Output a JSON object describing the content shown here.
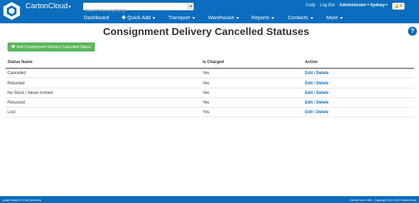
{
  "header": {
    "brand": "CartonCloud",
    "search": {
      "placeholder": "Search for anything!",
      "value": ""
    },
    "user": "Cody",
    "logout": "Log Out",
    "role": "Administrator",
    "location": "Sydney",
    "notifications": "0",
    "colors": {
      "primary": "#0a6dbd"
    }
  },
  "nav": [
    {
      "label": "Dashboard",
      "icon": ""
    },
    {
      "label": "Quick Add",
      "icon": "plus-icon"
    },
    {
      "label": "Transport",
      "icon": ""
    },
    {
      "label": "Warehouse",
      "icon": ""
    },
    {
      "label": "Reports",
      "icon": ""
    },
    {
      "label": "Contacts",
      "icon": ""
    },
    {
      "label": "More",
      "icon": ""
    }
  ],
  "page": {
    "title": "Consignment Delivery Cancelled Statuses",
    "add_button": "Add Consignment Delivery Cancelled Status",
    "add_button_color": "#5cb85c"
  },
  "table": {
    "headers": [
      "Status Name",
      "Is Charged",
      "Action"
    ],
    "rows": [
      {
        "name": "Cancelled",
        "charged": "Yes",
        "edit": "Edit",
        "sep": "/",
        "delete": "Delete"
      },
      {
        "name": "Returned",
        "charged": "Yes",
        "edit": "Edit",
        "sep": "/",
        "delete": "Delete"
      },
      {
        "name": "No Stock / Never Arrived",
        "charged": "Yes",
        "edit": "Edit",
        "sep": "/",
        "delete": "Delete"
      },
      {
        "name": "Reissued",
        "charged": "Yes",
        "edit": "Edit",
        "sep": "/",
        "delete": "Delete"
      },
      {
        "name": "Lost",
        "charged": "Yes",
        "edit": "Edit",
        "sep": "/",
        "delete": "Delete"
      }
    ]
  },
  "footer": {
    "left": "(page loaded in 0.064 seconds)",
    "right": "CartonCloud v406 - Copyright 2012-2020 CartonCloud"
  }
}
